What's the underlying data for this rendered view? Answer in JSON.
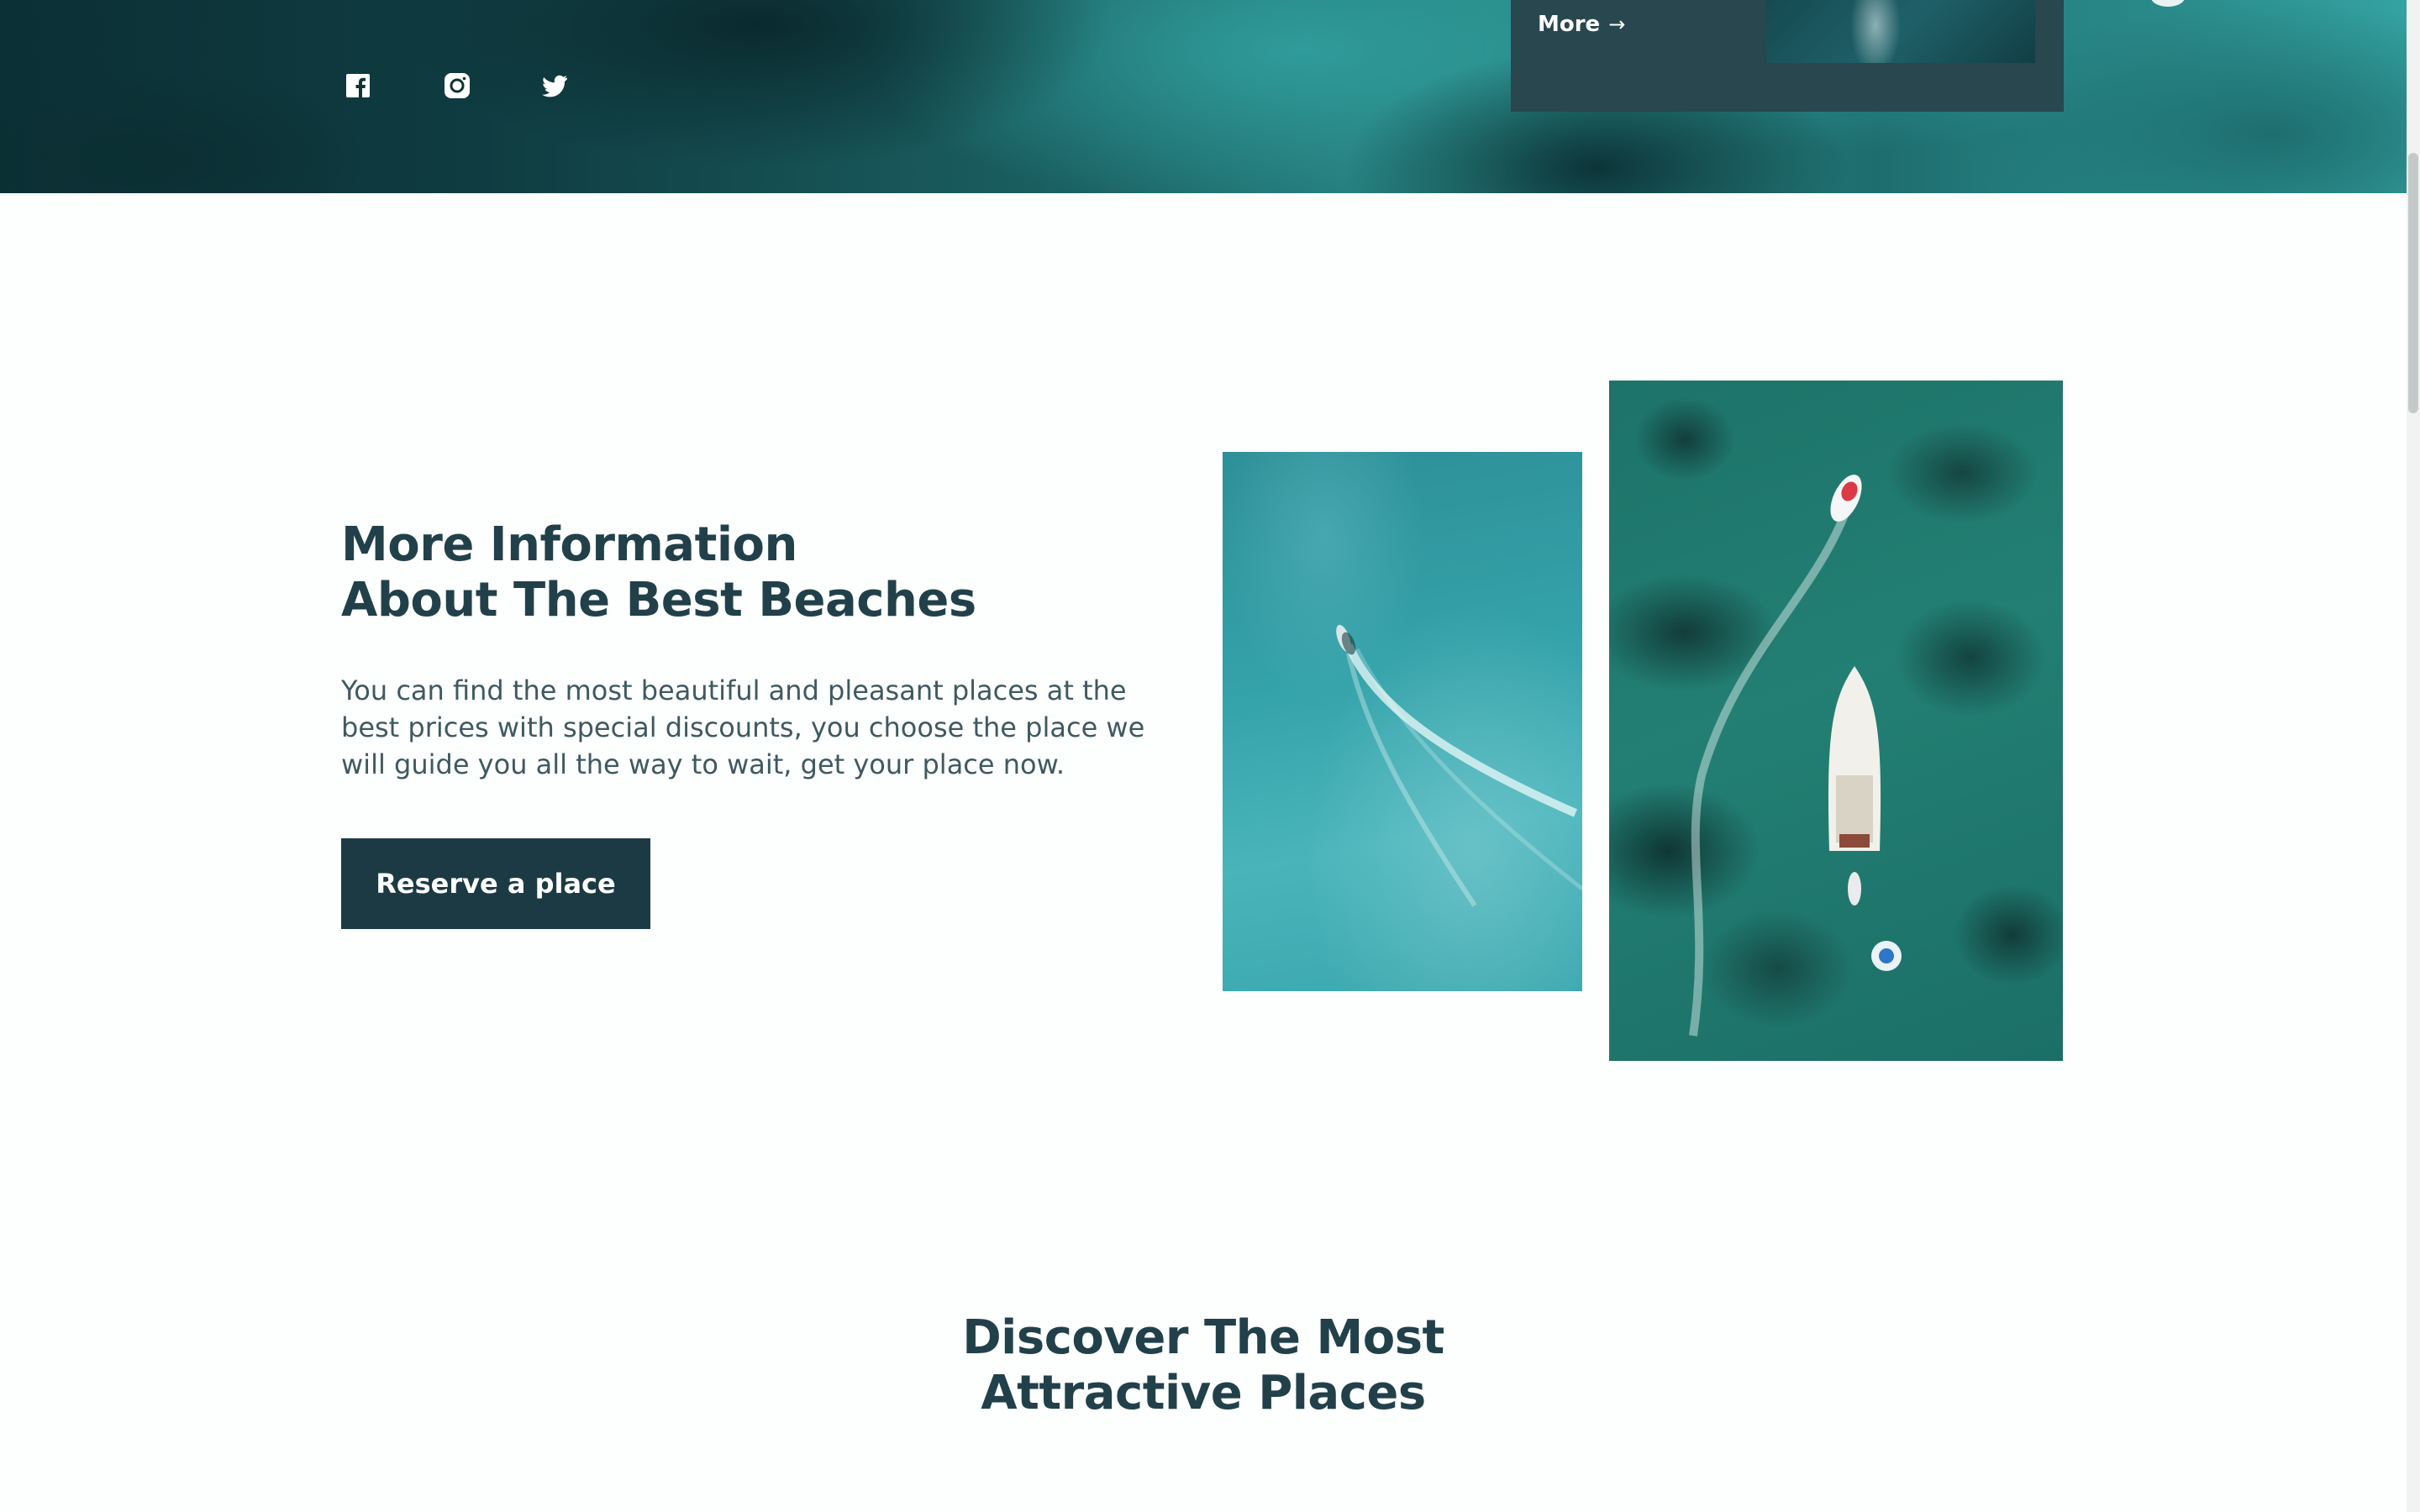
{
  "hero": {
    "card": {
      "more_label": "More",
      "arrow_icon": "arrow-right-icon"
    },
    "social": [
      {
        "name": "facebook",
        "icon": "facebook-icon"
      },
      {
        "name": "instagram",
        "icon": "instagram-icon"
      },
      {
        "name": "twitter",
        "icon": "twitter-icon"
      }
    ]
  },
  "info": {
    "title_line1": "More Information",
    "title_line2": "About The Best Beaches",
    "text": "You can find the most beautiful and pleasant places at the best prices with special discounts, you choose the place we will guide you all the way to wait, get your place now.",
    "button_label": "Reserve a place"
  },
  "discover": {
    "title_line1": "Discover The Most",
    "title_line2": "Attractive Places"
  },
  "colors": {
    "primary_dark": "#1c3a44",
    "heading": "#21404a",
    "body_text": "#3f5960",
    "card_bg": "#28474e"
  }
}
